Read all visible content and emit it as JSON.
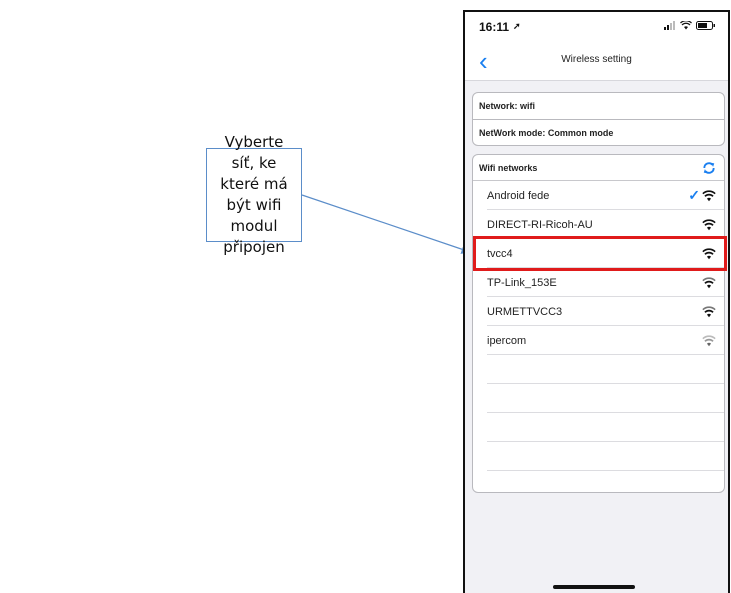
{
  "callout": {
    "text": "Vyberte síť, ke které má být wifi modul připojen"
  },
  "status": {
    "time": "16:11"
  },
  "nav": {
    "title": "Wireless setting"
  },
  "info": {
    "network": "Network:  wifi",
    "mode": "NetWork mode:  Common mode"
  },
  "wifi": {
    "header": "Wifi networks",
    "networks": [
      {
        "name": "Android fede",
        "connected": true
      },
      {
        "name": "DIRECT-RI-Ricoh-AU",
        "connected": false
      },
      {
        "name": "tvcc4",
        "connected": false
      },
      {
        "name": "TP-Link_153E",
        "connected": false
      },
      {
        "name": "URMETTVCC3",
        "connected": false
      },
      {
        "name": "ipercom",
        "connected": false
      }
    ]
  },
  "colors": {
    "accent": "#1a7ff0",
    "highlight": "#e01b1b",
    "callout_border": "#5b8dc9"
  }
}
